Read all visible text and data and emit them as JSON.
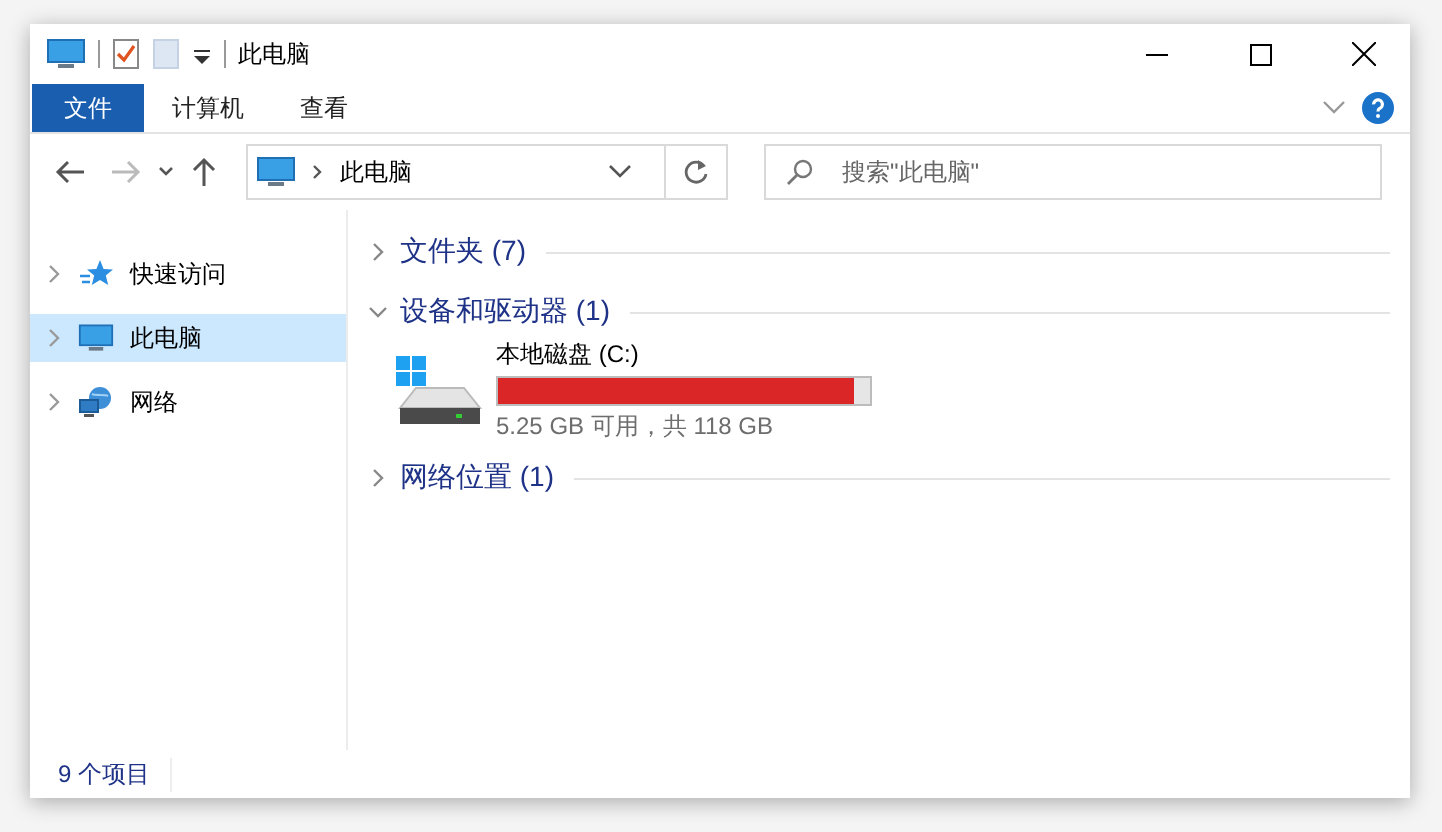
{
  "window": {
    "title": "此电脑"
  },
  "ribbon_tabs": [
    {
      "label": "文件",
      "selected": true
    },
    {
      "label": "计算机",
      "selected": false
    },
    {
      "label": "查看",
      "selected": false
    }
  ],
  "nav_buttons": [
    {
      "kind": "back",
      "disabled": false
    },
    {
      "kind": "forward",
      "disabled": true
    },
    {
      "kind": "recent",
      "disabled": false
    },
    {
      "kind": "up",
      "disabled": false
    }
  ],
  "address": {
    "path": "此电脑"
  },
  "search": {
    "placeholder": "搜索\"此电脑\""
  },
  "sidebar": {
    "items": [
      {
        "label": "快速访问",
        "kind": "star",
        "selected": false
      },
      {
        "label": "此电脑",
        "kind": "computer",
        "selected": true
      },
      {
        "label": "网络",
        "kind": "network",
        "selected": false
      }
    ]
  },
  "groups": [
    {
      "title": "文件夹 (7)",
      "expanded": false
    },
    {
      "title": "设备和驱动器 (1)",
      "expanded": true,
      "drives": [
        {
          "name": "本地磁盘 (C:)",
          "level": 0.955,
          "space": "5.25 GB 可用，共 118 GB"
        }
      ]
    },
    {
      "title": "网络位置 (1)",
      "expanded": false
    }
  ],
  "status_bar": {
    "text": "9 个项目"
  }
}
